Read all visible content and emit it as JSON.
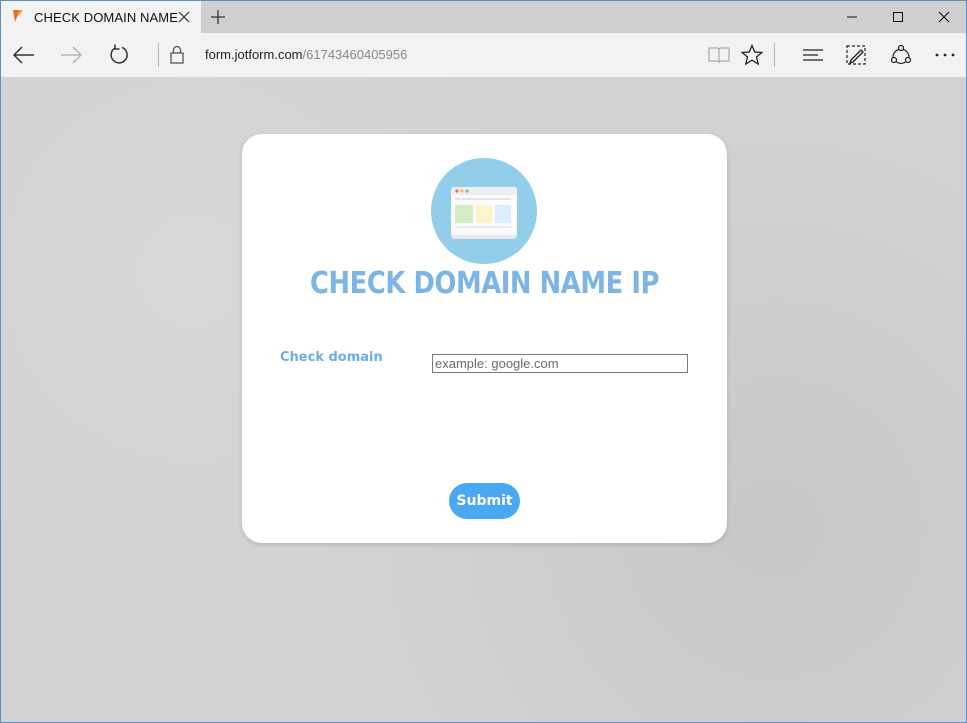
{
  "browser": {
    "tab": {
      "title": "CHECK DOMAIN NAME"
    },
    "address": {
      "host": "form.jotform.com",
      "path": "/61743460405956"
    }
  },
  "form": {
    "title": "CHECK DOMAIN NAME IP",
    "field": {
      "label": "Check domain",
      "placeholder": "example: google.com",
      "value": ""
    },
    "submit_label": "Submit"
  },
  "colors": {
    "accent": "#4aa7f2",
    "title": "#7db4e6",
    "label": "#6aaeea"
  }
}
